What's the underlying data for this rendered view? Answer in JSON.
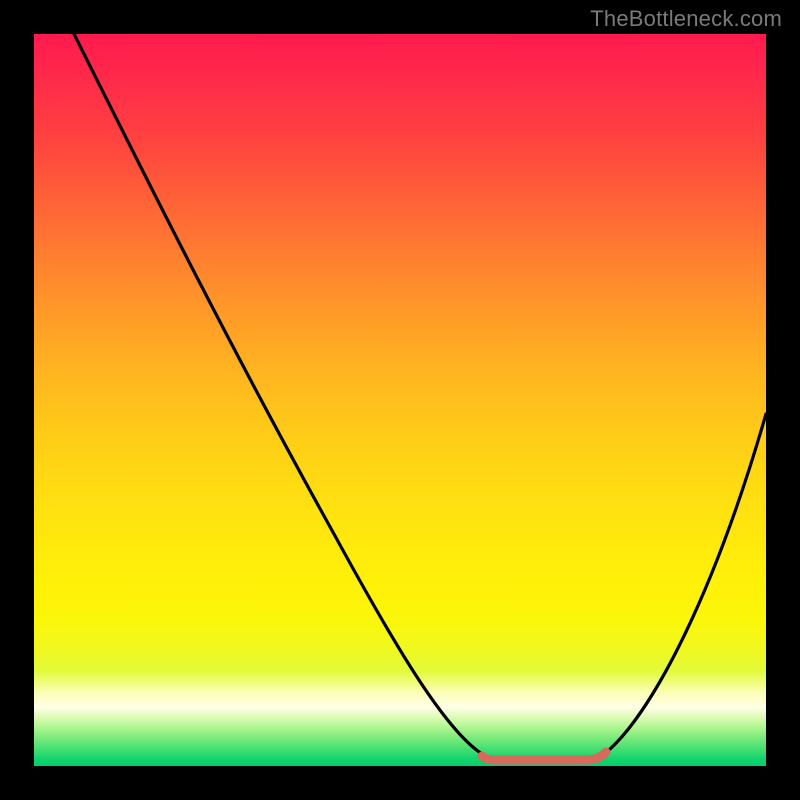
{
  "watermark": "TheBottleneck.com",
  "chart_data": {
    "type": "line",
    "title": "",
    "xlabel": "",
    "ylabel": "",
    "xlim": [
      0,
      100
    ],
    "ylim": [
      0,
      100
    ],
    "grid": false,
    "series": [
      {
        "name": "bottleneck-curve",
        "x": [
          0,
          10,
          20,
          30,
          40,
          50,
          55,
          60,
          63,
          67,
          70,
          75,
          80,
          85,
          90,
          95,
          100
        ],
        "values": [
          100,
          86,
          72,
          58,
          44,
          28,
          18,
          8,
          2,
          2,
          2,
          2,
          6,
          14,
          25,
          38,
          52
        ]
      }
    ],
    "optimum_marker": {
      "x_range": [
        62,
        76
      ],
      "y": 2,
      "color": "#d66a5c"
    },
    "background_gradient": {
      "stops": [
        {
          "pos": 0,
          "color": "#ff1a4d"
        },
        {
          "pos": 0.5,
          "color": "#ffc81a"
        },
        {
          "pos": 0.8,
          "color": "#fbf60a"
        },
        {
          "pos": 0.92,
          "color": "#ffffe8"
        },
        {
          "pos": 1.0,
          "color": "#02cf6b"
        }
      ]
    }
  }
}
